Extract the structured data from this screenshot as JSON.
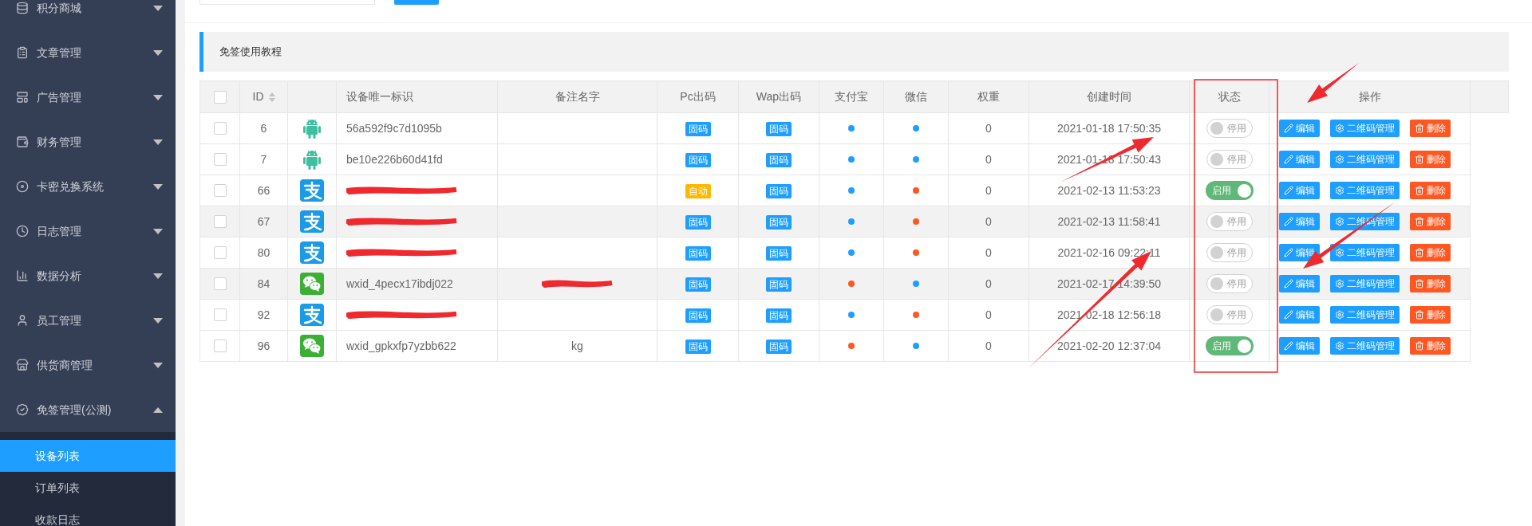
{
  "sidebar": {
    "items": [
      {
        "label": "积分商城",
        "expanded": false
      },
      {
        "label": "文章管理",
        "expanded": false
      },
      {
        "label": "广告管理",
        "expanded": false
      },
      {
        "label": "财务管理",
        "expanded": false
      },
      {
        "label": "卡密兑换系统",
        "expanded": false
      },
      {
        "label": "日志管理",
        "expanded": false
      },
      {
        "label": "数据分析",
        "expanded": false
      },
      {
        "label": "员工管理",
        "expanded": false
      },
      {
        "label": "供货商管理",
        "expanded": false
      },
      {
        "label": "免签管理(公测)",
        "expanded": true,
        "children": [
          {
            "label": "设备列表",
            "selected": true
          },
          {
            "label": "订单列表",
            "selected": false
          },
          {
            "label": "收款日志",
            "selected": false
          }
        ]
      }
    ]
  },
  "notice": {
    "text": "免签使用教程"
  },
  "table": {
    "header_checkbox": {
      "checked": false
    },
    "columns": [
      "ID",
      "",
      "设备唯一标识",
      "备注名字",
      "Pc出码",
      "Wap出码",
      "支付宝",
      "微信",
      "权重",
      "创建时间",
      "状态",
      "操作"
    ],
    "rows": [
      {
        "checked": false,
        "shaded": false,
        "id": "6",
        "platform": {
          "kind": "android"
        },
        "device_id": "56a592f9c7d1095b",
        "device_id_redacted": false,
        "remark_redacted": false,
        "pc": {
          "kind": "fixed",
          "label": "固码"
        },
        "wap": {
          "kind": "fixed",
          "label": "固码"
        },
        "alipay": {
          "color": "#1e9fff"
        },
        "wechat": {
          "color": "#1e9fff"
        },
        "weight": "0",
        "created": "2021-01-18 17:50:35",
        "status": {
          "on": false,
          "label": "停用"
        },
        "actions": [
          {
            "kind": "edit",
            "label": "编辑"
          },
          {
            "kind": "qr",
            "label": "二维码管理"
          },
          {
            "kind": "delete",
            "label": "删除"
          }
        ]
      },
      {
        "checked": false,
        "shaded": false,
        "id": "7",
        "platform": {
          "kind": "android"
        },
        "device_id": "be10e226b60d41fd",
        "device_id_redacted": false,
        "remark_redacted": false,
        "pc": {
          "kind": "fixed",
          "label": "固码"
        },
        "wap": {
          "kind": "fixed",
          "label": "固码"
        },
        "alipay": {
          "color": "#1e9fff"
        },
        "wechat": {
          "color": "#1e9fff"
        },
        "weight": "0",
        "created": "2021-01-18 17:50:43",
        "status": {
          "on": false,
          "label": "停用"
        },
        "actions": [
          {
            "kind": "edit",
            "label": "编辑"
          },
          {
            "kind": "qr",
            "label": "二维码管理"
          },
          {
            "kind": "delete",
            "label": "删除"
          }
        ]
      },
      {
        "checked": false,
        "shaded": false,
        "id": "66",
        "platform": {
          "kind": "alipay"
        },
        "device_id_redacted": true,
        "remark_redacted": false,
        "pc": {
          "kind": "auto",
          "label": "自动"
        },
        "wap": {
          "kind": "fixed",
          "label": "固码"
        },
        "alipay": {
          "color": "#1e9fff"
        },
        "wechat": {
          "color": "#ff5722"
        },
        "weight": "0",
        "created": "2021-02-13 11:53:23",
        "status": {
          "on": true,
          "label": "启用"
        },
        "actions": [
          {
            "kind": "edit",
            "label": "编辑"
          },
          {
            "kind": "qr",
            "label": "二维码管理"
          },
          {
            "kind": "delete",
            "label": "删除"
          }
        ]
      },
      {
        "checked": false,
        "shaded": true,
        "id": "67",
        "platform": {
          "kind": "alipay"
        },
        "device_id_redacted": true,
        "remark_redacted": false,
        "pc": {
          "kind": "fixed",
          "label": "固码"
        },
        "wap": {
          "kind": "fixed",
          "label": "固码"
        },
        "alipay": {
          "color": "#1e9fff"
        },
        "wechat": {
          "color": "#ff5722"
        },
        "weight": "0",
        "created": "2021-02-13 11:58:41",
        "status": {
          "on": false,
          "label": "停用"
        },
        "actions": [
          {
            "kind": "edit",
            "label": "编辑"
          },
          {
            "kind": "qr",
            "label": "二维码管理"
          },
          {
            "kind": "delete",
            "label": "删除"
          }
        ]
      },
      {
        "checked": false,
        "shaded": false,
        "id": "80",
        "platform": {
          "kind": "alipay"
        },
        "device_id_redacted": true,
        "remark_redacted": false,
        "pc": {
          "kind": "fixed",
          "label": "固码"
        },
        "wap": {
          "kind": "fixed",
          "label": "固码"
        },
        "alipay": {
          "color": "#1e9fff"
        },
        "wechat": {
          "color": "#ff5722"
        },
        "weight": "0",
        "created": "2021-02-16 09:22:11",
        "status": {
          "on": false,
          "label": "停用"
        },
        "actions": [
          {
            "kind": "edit",
            "label": "编辑"
          },
          {
            "kind": "qr",
            "label": "二维码管理"
          },
          {
            "kind": "delete",
            "label": "删除"
          }
        ]
      },
      {
        "checked": false,
        "shaded": true,
        "id": "84",
        "platform": {
          "kind": "wechat"
        },
        "device_id": "wxid_4pecx17ibdj022",
        "device_id_redacted": false,
        "remark_redacted": true,
        "pc": {
          "kind": "fixed",
          "label": "固码"
        },
        "wap": {
          "kind": "fixed",
          "label": "固码"
        },
        "alipay": {
          "color": "#ff5722"
        },
        "wechat": {
          "color": "#1e9fff"
        },
        "weight": "0",
        "created": "2021-02-17 14:39:50",
        "status": {
          "on": false,
          "label": "停用"
        },
        "actions": [
          {
            "kind": "edit",
            "label": "编辑"
          },
          {
            "kind": "qr",
            "label": "二维码管理"
          },
          {
            "kind": "delete",
            "label": "删除"
          }
        ]
      },
      {
        "checked": false,
        "shaded": false,
        "id": "92",
        "platform": {
          "kind": "alipay"
        },
        "device_id_redacted": true,
        "remark_redacted": false,
        "pc": {
          "kind": "fixed",
          "label": "固码"
        },
        "wap": {
          "kind": "fixed",
          "label": "固码"
        },
        "alipay": {
          "color": "#1e9fff"
        },
        "wechat": {
          "color": "#ff5722"
        },
        "weight": "0",
        "created": "2021-02-18 12:56:18",
        "status": {
          "on": false,
          "label": "停用"
        },
        "actions": [
          {
            "kind": "edit",
            "label": "编辑"
          },
          {
            "kind": "qr",
            "label": "二维码管理"
          },
          {
            "kind": "delete",
            "label": "删除"
          }
        ]
      },
      {
        "checked": false,
        "shaded": false,
        "id": "96",
        "platform": {
          "kind": "wechat"
        },
        "device_id": "wxid_gpkxfp7yzbb622",
        "device_id_redacted": false,
        "remark": "kg",
        "remark_redacted": false,
        "pc": {
          "kind": "fixed",
          "label": "固码"
        },
        "wap": {
          "kind": "fixed",
          "label": "固码"
        },
        "alipay": {
          "color": "#ff5722"
        },
        "wechat": {
          "color": "#1e9fff"
        },
        "weight": "0",
        "created": "2021-02-20 12:37:04",
        "status": {
          "on": true,
          "label": "启用"
        },
        "actions": [
          {
            "kind": "edit",
            "label": "编辑"
          },
          {
            "kind": "qr",
            "label": "二维码管理"
          },
          {
            "kind": "delete",
            "label": "删除"
          }
        ]
      }
    ]
  }
}
